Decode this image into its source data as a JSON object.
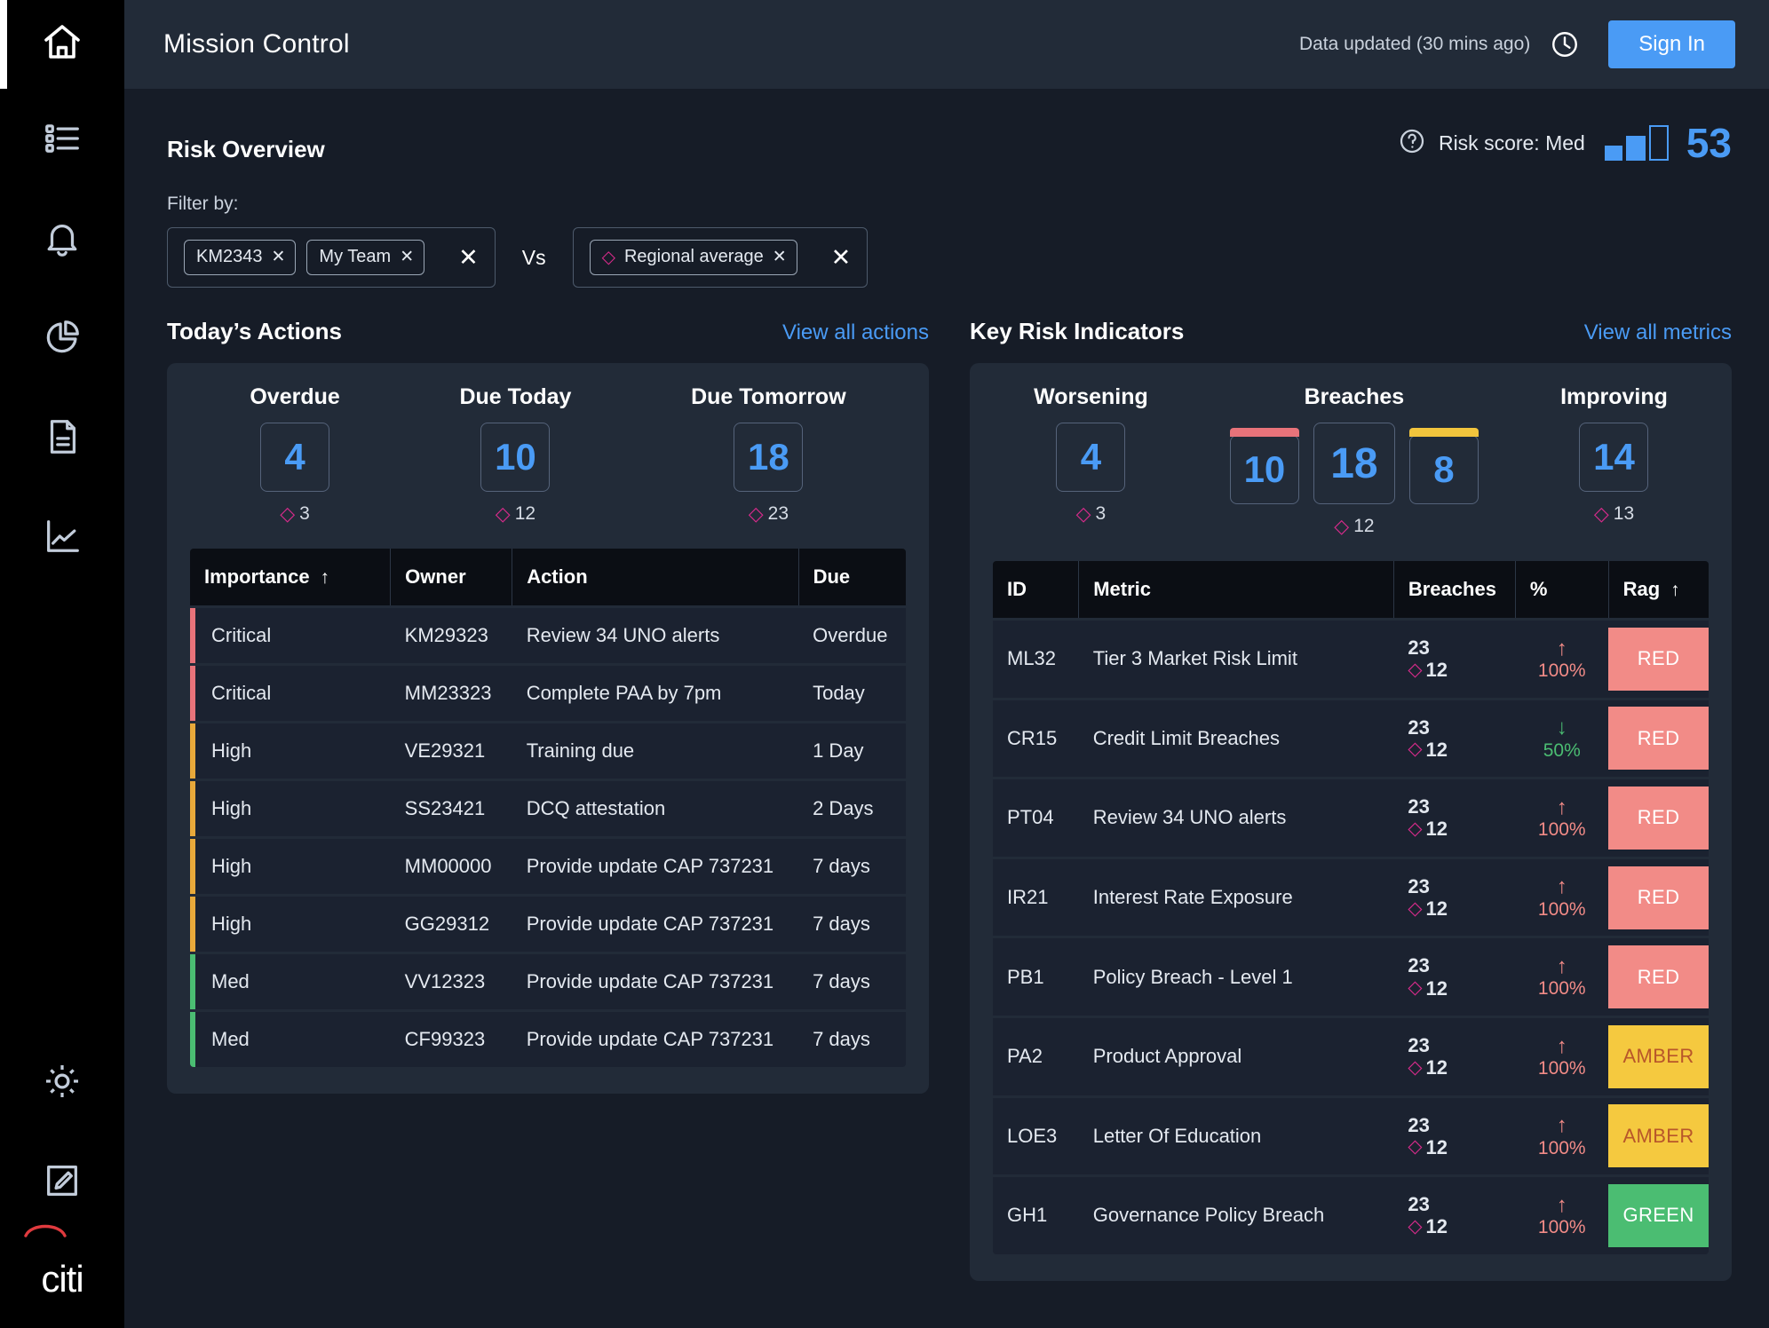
{
  "sidebar": {
    "items": [
      {
        "name": "home",
        "icon": "home-icon",
        "active": true
      },
      {
        "name": "tasks",
        "icon": "list-icon",
        "active": false
      },
      {
        "name": "alerts",
        "icon": "bell-icon",
        "active": false
      },
      {
        "name": "reports",
        "icon": "pie-chart-icon",
        "active": false
      },
      {
        "name": "documents",
        "icon": "document-icon",
        "active": false
      },
      {
        "name": "analytics",
        "icon": "line-chart-icon",
        "active": false
      }
    ],
    "bottom_items": [
      {
        "name": "settings",
        "icon": "gear-icon"
      },
      {
        "name": "edit",
        "icon": "edit-square-icon"
      }
    ],
    "logo_text": "citi"
  },
  "header": {
    "title": "Mission Control",
    "data_updated": "Data updated (30 mins ago)",
    "clock_icon": "clock-icon",
    "sign_in_label": "Sign In"
  },
  "risk_overview": {
    "title": "Risk Overview",
    "help_icon": "question-circle-icon",
    "score_label": "Risk score: Med",
    "score_value": "53",
    "accent_blue": "#4a9bf5",
    "filter_label": "Filter by:",
    "vs_label": "Vs",
    "left_chips": [
      {
        "label": "KM2343",
        "remove_icon": "close-icon"
      },
      {
        "label": "My Team",
        "remove_icon": "close-icon"
      }
    ],
    "left_clear_icon": "close-icon",
    "right_chips": [
      {
        "label": "Regional average",
        "marker": "diamond",
        "remove_icon": "close-icon"
      }
    ],
    "right_clear_icon": "close-icon"
  },
  "actions": {
    "title": "Today’s Actions",
    "link": "View all actions",
    "stats": [
      {
        "label": "Overdue",
        "boxes": [
          {
            "value": "4",
            "accent": null
          }
        ],
        "sub": "3"
      },
      {
        "label": "Due Today",
        "boxes": [
          {
            "value": "10",
            "accent": null
          }
        ],
        "sub": "12"
      },
      {
        "label": "Due Tomorrow",
        "boxes": [
          {
            "value": "18",
            "accent": null
          }
        ],
        "sub": "23"
      }
    ],
    "columns": [
      "Importance",
      "Owner",
      "Action",
      "Due"
    ],
    "sort_column": "Importance",
    "sort_icon": "arrow-up-icon",
    "rows": [
      {
        "importance": "Critical",
        "owner": "KM29323",
        "action": "Review 34 UNO alerts",
        "due": "Overdue",
        "color": "#e8737a"
      },
      {
        "importance": "Critical",
        "owner": "MM23323",
        "action": "Complete PAA by 7pm",
        "due": "Today",
        "color": "#e8737a"
      },
      {
        "importance": "High",
        "owner": "VE29321",
        "action": "Training due",
        "due": "1 Day",
        "color": "#e8a93a"
      },
      {
        "importance": "High",
        "owner": "SS23421",
        "action": "DCQ attestation",
        "due": "2 Days",
        "color": "#e8a93a"
      },
      {
        "importance": "High",
        "owner": "MM00000",
        "action": "Provide update CAP 737231",
        "due": "7 days",
        "color": "#e8a93a"
      },
      {
        "importance": "High",
        "owner": "GG29312",
        "action": "Provide update CAP 737231",
        "due": "7 days",
        "color": "#e8a93a"
      },
      {
        "importance": "Med",
        "owner": "VV12323",
        "action": "Provide update CAP 737231",
        "due": "7 days",
        "color": "#4bbd72"
      },
      {
        "importance": "Med",
        "owner": "CF99323",
        "action": "Provide update CAP 737231",
        "due": "7 days",
        "color": "#4bbd72"
      }
    ]
  },
  "kri": {
    "title": "Key Risk Indicators",
    "link": "View all metrics",
    "stats": [
      {
        "label": "Worsening",
        "boxes": [
          {
            "value": "4",
            "accent": null
          }
        ],
        "sub": "3"
      },
      {
        "label": "Breaches",
        "boxes": [
          {
            "value": "10",
            "accent": "#e8737a"
          },
          {
            "value": "18",
            "accent": null,
            "big": true
          },
          {
            "value": "8",
            "accent": "#f2c53d"
          }
        ],
        "sub": "12"
      },
      {
        "label": "Improving",
        "boxes": [
          {
            "value": "14",
            "accent": null
          }
        ],
        "sub": "13"
      }
    ],
    "columns": [
      "ID",
      "Metric",
      "Breaches",
      "%",
      "Rag"
    ],
    "sort_column": "Rag",
    "sort_icon": "arrow-up-icon",
    "rows": [
      {
        "id": "ML32",
        "metric": "Tier 3 Market Risk Limit",
        "breaches": "23",
        "sub": "12",
        "trend": "up",
        "pct": "100%",
        "rag": "RED",
        "rag_bg": "#f28b87",
        "rag_fg": "#ffffff"
      },
      {
        "id": "CR15",
        "metric": "Credit Limit Breaches",
        "breaches": "23",
        "sub": "12",
        "trend": "down",
        "pct": "50%",
        "rag": "RED",
        "rag_bg": "#f28b87",
        "rag_fg": "#ffffff"
      },
      {
        "id": "PT04",
        "metric": "Review 34 UNO alerts",
        "breaches": "23",
        "sub": "12",
        "trend": "up",
        "pct": "100%",
        "rag": "RED",
        "rag_bg": "#f28b87",
        "rag_fg": "#ffffff"
      },
      {
        "id": "IR21",
        "metric": "Interest Rate Exposure",
        "breaches": "23",
        "sub": "12",
        "trend": "up",
        "pct": "100%",
        "rag": "RED",
        "rag_bg": "#f28b87",
        "rag_fg": "#ffffff"
      },
      {
        "id": "PB1",
        "metric": "Policy Breach - Level 1",
        "breaches": "23",
        "sub": "12",
        "trend": "up",
        "pct": "100%",
        "rag": "RED",
        "rag_bg": "#f28b87",
        "rag_fg": "#ffffff"
      },
      {
        "id": "PA2",
        "metric": "Product Approval",
        "breaches": "23",
        "sub": "12",
        "trend": "up",
        "pct": "100%",
        "rag": "AMBER",
        "rag_bg": "#f5c93f",
        "rag_fg": "#b8562a"
      },
      {
        "id": "LOE3",
        "metric": "Letter Of Education",
        "breaches": "23",
        "sub": "12",
        "trend": "up",
        "pct": "100%",
        "rag": "AMBER",
        "rag_bg": "#f5c93f",
        "rag_fg": "#b8562a"
      },
      {
        "id": "GH1",
        "metric": "Governance Policy Breach",
        "breaches": "23",
        "sub": "12",
        "trend": "up",
        "pct": "100%",
        "rag": "GREEN",
        "rag_bg": "#4bbd72",
        "rag_fg": "#ffffff"
      }
    ],
    "trend_up_color": "#f28b87",
    "trend_down_color": "#4bbd72"
  }
}
